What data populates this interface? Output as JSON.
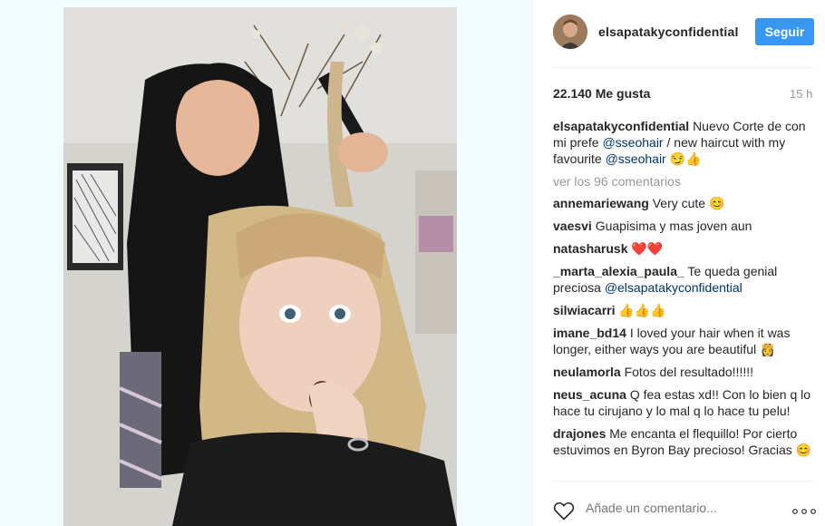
{
  "post": {
    "username": "elsapatakyconfidential",
    "follow_label": "Seguir",
    "likes": "22.140 Me gusta",
    "time_ago": "15 h",
    "caption": {
      "user": "elsapatakyconfidential",
      "text1": "Nuevo Corte de con mi prefe ",
      "mention1": "@sseohair",
      "text2": " / new haircut with my favourite ",
      "mention2": "@sseohair",
      "text3": " 😏👍"
    },
    "view_all": "ver los 96 comentarios",
    "comments": [
      {
        "user": "annemariewang",
        "text": "Very cute 😊"
      },
      {
        "user": "vaesvi",
        "text": "Guapisima y mas joven aun"
      },
      {
        "user": "natasharusk",
        "text": "❤️❤️"
      },
      {
        "user": "_marta_alexia_paula_",
        "text": "Te queda genial preciosa ",
        "mention": "@elsapatakyconfidential"
      },
      {
        "user": "silwiacarri",
        "text": "👍👍👍"
      },
      {
        "user": "imane_bd14",
        "text": "I loved your hair when it was longer, either ways you are beautiful 👸"
      },
      {
        "user": "neulamorla",
        "text": "Fotos del resultado!!!!!!"
      },
      {
        "user": "neus_acuna",
        "text": "Q fea estas xd!! Con lo bien q lo hace tu cirujano y lo mal q lo hace tu pelu!"
      },
      {
        "user": "drajones",
        "text": "Me encanta el flequillo! Por cierto estuvimos en Byron Bay precioso! Gracias 😊"
      }
    ],
    "add_comment_placeholder": "Añade un comentario...",
    "icons": {
      "like": "heart-outline-icon",
      "more": "ellipsis-icon"
    }
  },
  "colors": {
    "accent": "#3897f0",
    "mention": "#003569",
    "muted": "#999999",
    "background_left": "#f0fcff"
  }
}
